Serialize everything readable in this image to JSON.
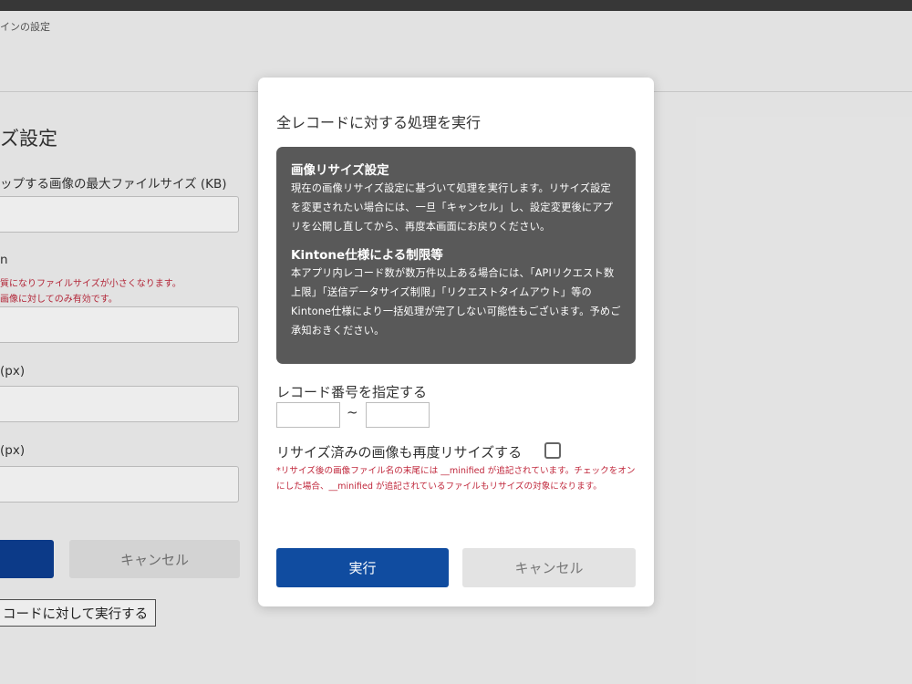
{
  "background": {
    "breadcrumb": "インの設定",
    "page_title": "ズ設定",
    "field_max_size_label": "ップする画像の最大ファイルサイズ (KB)",
    "field_quality_label": "n",
    "field_quality_note_1": "質になりファイルサイズが小さくなります。",
    "field_quality_note_2": "画像に対してのみ有効です。",
    "field_width_label": "(px)",
    "field_height_label": "(px)",
    "cancel_label": "キャンセル",
    "run_all_label": "コードに対して実行する"
  },
  "modal": {
    "title": "全レコードに対する処理を実行",
    "info": {
      "heading1": "画像リサイズ設定",
      "text1": "現在の画像リサイズ設定に基づいて処理を実行します。リサイズ設定を変更されたい場合には、一旦「キャンセル」し、設定変更後にアプリを公開し直してから、再度本画面にお戻りください。",
      "heading2": "Kintone仕様による制限等",
      "text2": "本アプリ内レコード数が数万件以上ある場合には、「APIリクエスト数上限」「送信データサイズ制限」「リクエストタイムアウト」等のKintone仕様により一括処理が完了しない可能性もございます。予めご承知おきください。"
    },
    "range_label": "レコード番号を指定する",
    "range_from": "",
    "range_to": "",
    "range_separator": "~",
    "resize_label": "リサイズ済みの画像も再度リサイズする",
    "resize_checked": false,
    "note": "*リサイズ後の画像ファイル名の末尾には __minified が追記されています。チェックをオンにした場合、__minified が追記されているファイルもリサイズの対象になります。",
    "run_label": "実行",
    "cancel_label": "キャンセル"
  },
  "colors": {
    "primary": "#104ca0",
    "info_bg": "#595959",
    "note_red": "#c0283c"
  }
}
